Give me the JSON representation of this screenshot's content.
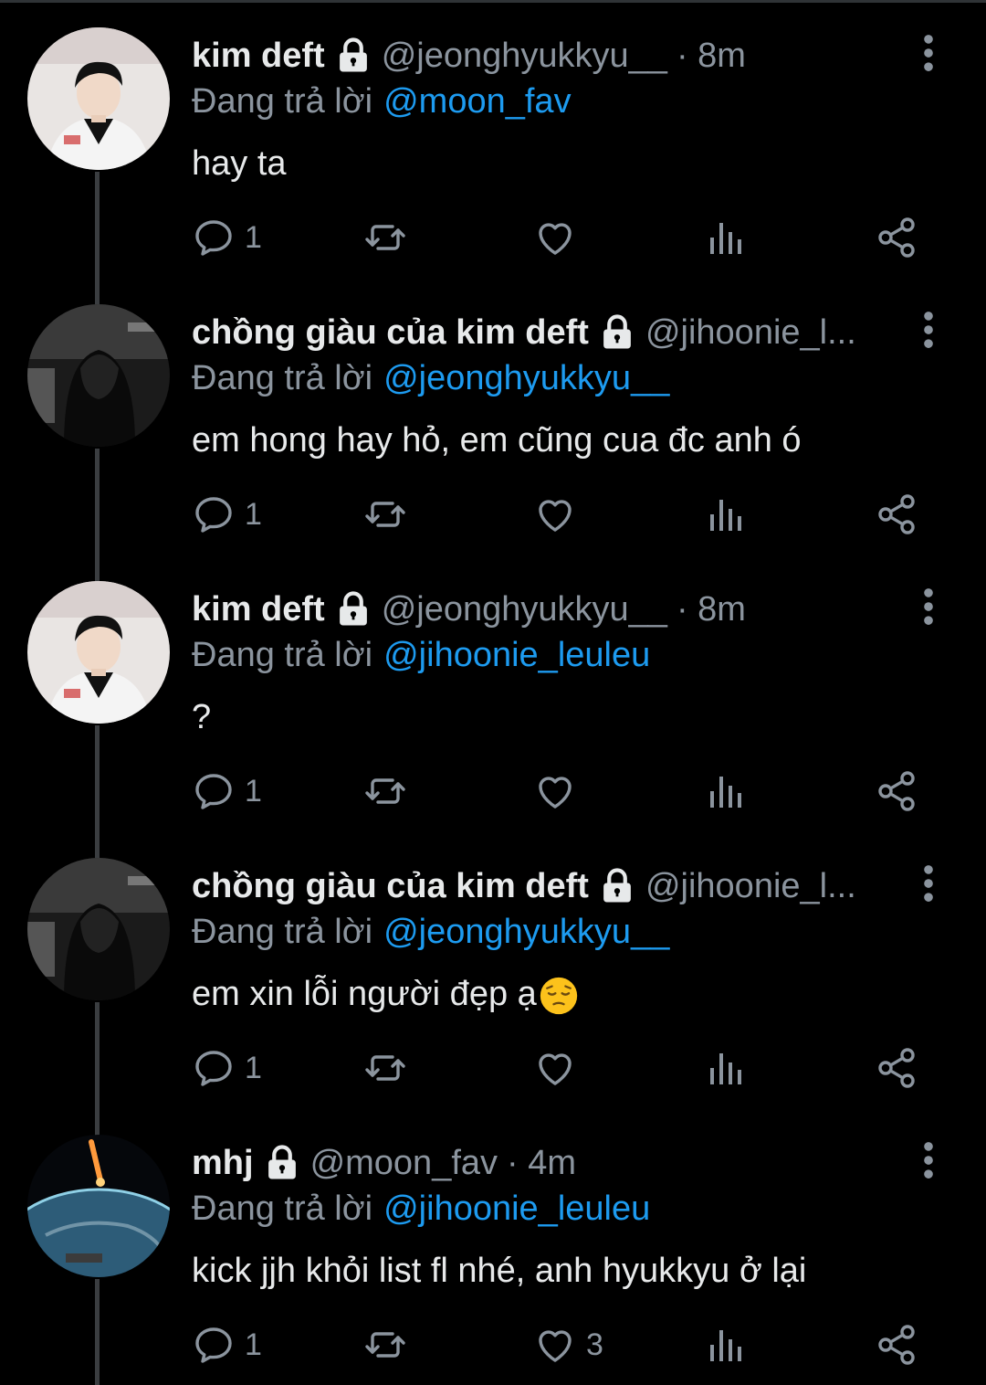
{
  "tweets": [
    {
      "display_name": "kim deft",
      "handle": "@jeonghyukkyu__",
      "time": "· 8m",
      "reply_prefix": "Đang trả lời",
      "reply_to": "@moon_fav",
      "text": "hay ta",
      "emoji": "",
      "reply_count": "1",
      "like_count": "",
      "avatar": "boy-avatar"
    },
    {
      "display_name": "chồng giàu của kim deft",
      "handle": "@jihoonie_l...",
      "time": "",
      "reply_prefix": "Đang trả lời",
      "reply_to": "@jeonghyukkyu__",
      "text": "em hong hay hỏ, em cũng cua đc anh ó",
      "emoji": "",
      "reply_count": "1",
      "like_count": "",
      "avatar": "dark-hoodie-avatar"
    },
    {
      "display_name": "kim deft",
      "handle": "@jeonghyukkyu__",
      "time": "· 8m",
      "reply_prefix": "Đang trả lời",
      "reply_to": "@jihoonie_leuleu",
      "text": "?",
      "emoji": "",
      "reply_count": "1",
      "like_count": "",
      "avatar": "boy-avatar"
    },
    {
      "display_name": "chồng giàu của kim deft",
      "handle": "@jihoonie_l...",
      "time": "",
      "reply_prefix": "Đang trả lời",
      "reply_to": "@jeonghyukkyu__",
      "text": "em xin lỗi người đẹp ạ",
      "emoji": "pensive-face",
      "reply_count": "1",
      "like_count": "",
      "avatar": "dark-hoodie-avatar"
    },
    {
      "display_name": "mhj",
      "handle": "@moon_fav",
      "time": "· 4m",
      "reply_prefix": "Đang trả lời",
      "reply_to": "@jihoonie_leuleu",
      "text": "kick jjh khỏi list fl nhé, anh hyukkyu ở lại",
      "emoji": "",
      "reply_count": "1",
      "like_count": "3",
      "avatar": "earth-meteor-avatar"
    }
  ],
  "colors": {
    "background": "#000000",
    "text": "#e7e9ea",
    "secondary": "#8b949e",
    "accent": "#1d9bf0",
    "thread_line": "#3a3d40"
  },
  "icons": [
    "lock-icon",
    "more-icon",
    "reply-icon",
    "retweet-icon",
    "like-icon",
    "views-icon",
    "share-icon"
  ]
}
